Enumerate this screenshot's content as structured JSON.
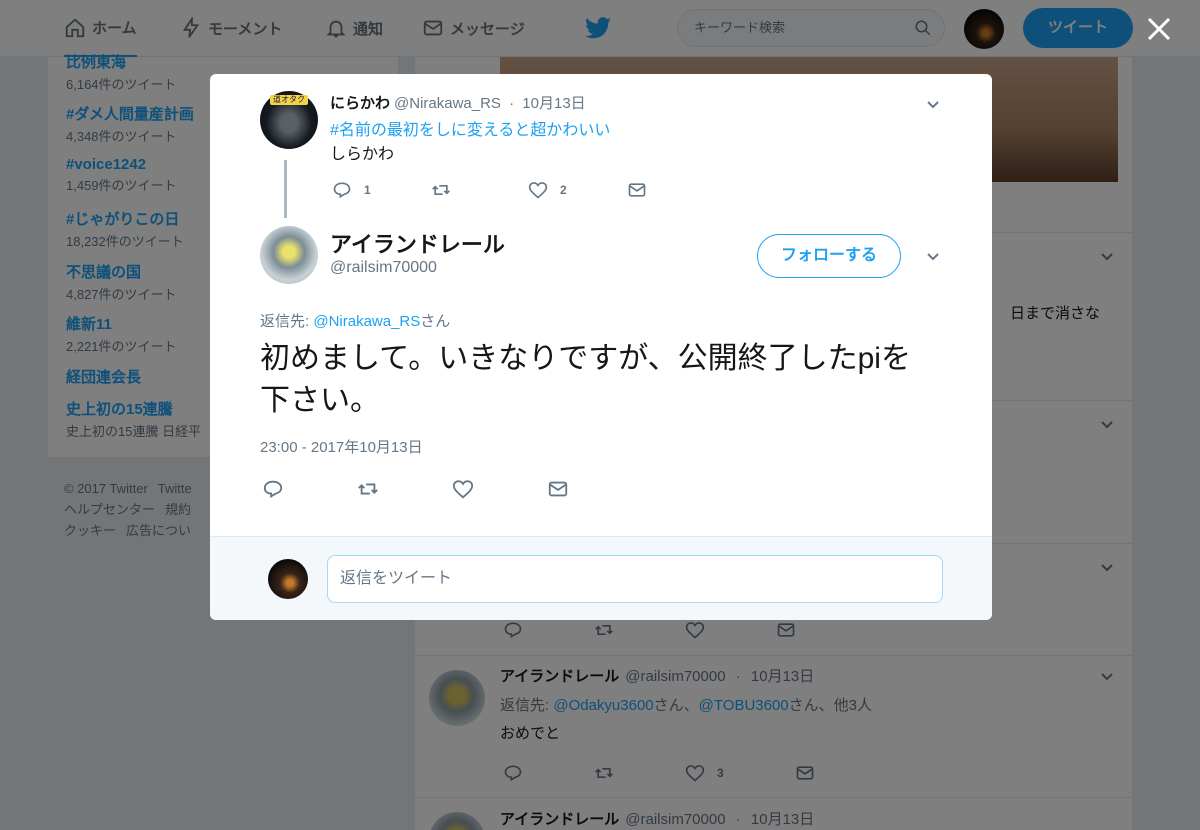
{
  "nav": {
    "home": "ホーム",
    "moments": "モーメント",
    "notifications": "通知",
    "messages": "メッセージ",
    "search_placeholder": "キーワード検索",
    "tweet_button": "ツイート"
  },
  "trends": [
    {
      "name": "比例東海",
      "count": "6,164件のツイート"
    },
    {
      "name": "#ダメ人間量産計画",
      "count": "4,348件のツイート"
    },
    {
      "name": "#voice1242",
      "count": "1,459件のツイート"
    },
    {
      "name": "#じゃがりこの日",
      "count": "18,232件のツイート"
    },
    {
      "name": "不思議の国",
      "count": "4,827件のツイート"
    },
    {
      "name": "維新11",
      "count": "2,221件のツイート"
    },
    {
      "name": "経団連会長",
      "count": ""
    },
    {
      "name": "史上初の15連騰",
      "count": "史上初の15連騰 日経平"
    }
  ],
  "footer": {
    "line1": [
      "© 2017 Twitter",
      "Twitte"
    ],
    "line2": [
      "ヘルプセンター",
      "規約"
    ],
    "line3": [
      "クッキー",
      "広告につい"
    ]
  },
  "feed": {
    "fragment": "日まで消さな",
    "tweet1": {
      "name": "アイランドレール",
      "handle": "@railsim70000",
      "date": "10月13日",
      "reply_prefix": "返信先:",
      "reply_to1": "@Odakyu3600",
      "san1": "さん、",
      "reply_to2": "@TOBU3600",
      "san2": "さん、他3人",
      "text": "おめでと",
      "likes": "3"
    },
    "tweet2": {
      "name": "アイランドレール",
      "handle": "@railsim70000",
      "date": "10月13日"
    }
  },
  "modal": {
    "parent": {
      "avatar_sign": "道オタク",
      "name": "にらかわ",
      "handle": "@Nirakawa_RS",
      "date": "10月13日",
      "hashtag": "#名前の最初をしに変えると超かわいい",
      "text": "しらかわ",
      "replies": "1",
      "likes": "2"
    },
    "main": {
      "name": "アイランドレール",
      "handle": "@railsim70000",
      "follow": "フォローする",
      "reply_prefix": "返信先:",
      "reply_to": "@Nirakawa_RS",
      "reply_suffix": "さん",
      "text": "初めまして。いきなりですが、公開終了したpiを下さい。",
      "timestamp": "23:00 - 2017年10月13日"
    },
    "reply_placeholder": "返信をツイート"
  },
  "colors": {
    "accent": "#1da1f2",
    "muted": "#657786",
    "like_red": "#e0245e"
  }
}
